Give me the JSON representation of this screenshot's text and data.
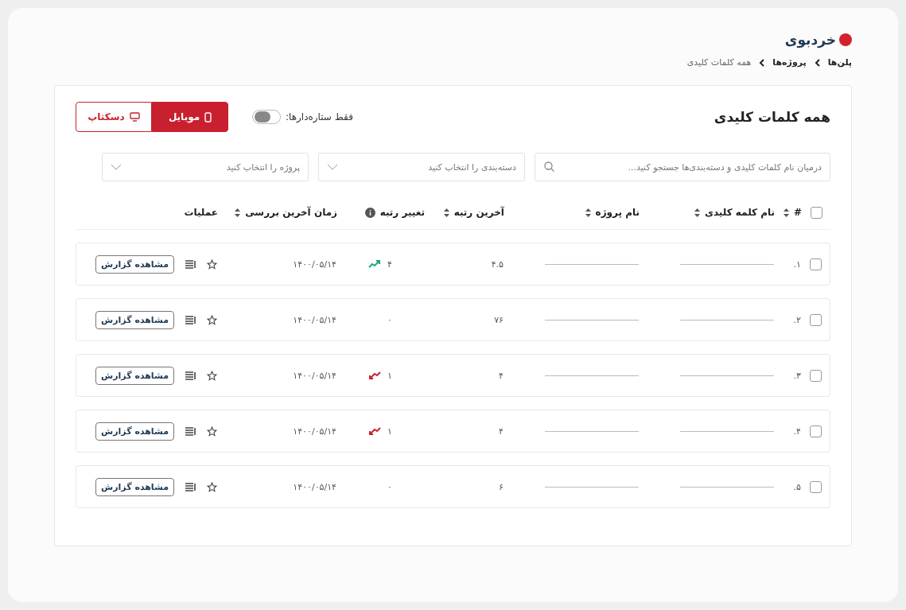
{
  "logo": {
    "text": "خردبوی"
  },
  "breadcrumb": [
    {
      "label": "پلن‌ها",
      "current": false
    },
    {
      "label": "پروژه‌ها",
      "current": false
    },
    {
      "label": "همه کلمات کلیدی",
      "current": true
    }
  ],
  "title": "همه کلمات کلیدی",
  "starred_filter": {
    "label": "فقط ستاره‌دارها:",
    "on": false
  },
  "device_tabs": [
    {
      "label": "موبایل",
      "kind": "mobile",
      "selected": true
    },
    {
      "label": "دسکتاپ",
      "kind": "desktop",
      "selected": false
    }
  ],
  "search": {
    "placeholder": "درمیان نام کلمات کلیدی و دسته‌بندی‌ها جستجو کنید..."
  },
  "selects": [
    {
      "placeholder": "دسته‌بندی را انتخاب کنید"
    },
    {
      "placeholder": "پروژه را انتخاب کنید"
    }
  ],
  "table": {
    "select_all": {
      "checked": false
    },
    "columns": [
      {
        "label": "#",
        "sortable": true
      },
      {
        "label": "نام کلمه کلیدی",
        "sortable": true
      },
      {
        "label": "نام پروژه",
        "sortable": true
      },
      {
        "label": "آخرین رتبه",
        "sortable": true
      },
      {
        "label": "تغییر رتبه",
        "sortable": false,
        "info": true
      },
      {
        "label": "زمان آخرین بررسی",
        "sortable": true
      },
      {
        "label": "عملیات",
        "sortable": false
      }
    ],
    "rows": [
      {
        "checked": false,
        "index": "۱.",
        "last_rank": "۴.۵",
        "change": "۴",
        "kind": "up",
        "checked_at": "۱۴۰۰/۰۵/۱۴",
        "starred": false,
        "action": "مشاهده گزارش"
      },
      {
        "checked": false,
        "index": "۲.",
        "last_rank": "۷۶",
        "change": "۰",
        "kind": "none",
        "checked_at": "۱۴۰۰/۰۵/۱۴",
        "starred": false,
        "action": "مشاهده گزارش"
      },
      {
        "checked": false,
        "index": "۳.",
        "last_rank": "۴",
        "change": "۱",
        "kind": "down",
        "checked_at": "۱۴۰۰/۰۵/۱۴",
        "starred": false,
        "action": "مشاهده گزارش"
      },
      {
        "checked": false,
        "index": "۴.",
        "last_rank": "۴",
        "change": "۱",
        "kind": "down",
        "checked_at": "۱۴۰۰/۰۵/۱۴",
        "starred": false,
        "action": "مشاهده گزارش"
      },
      {
        "checked": false,
        "index": "۵.",
        "last_rank": "۶",
        "change": "۰",
        "kind": "none",
        "checked_at": "۱۴۰۰/۰۵/۱۴",
        "starred": false,
        "action": "مشاهده گزارش"
      }
    ]
  }
}
